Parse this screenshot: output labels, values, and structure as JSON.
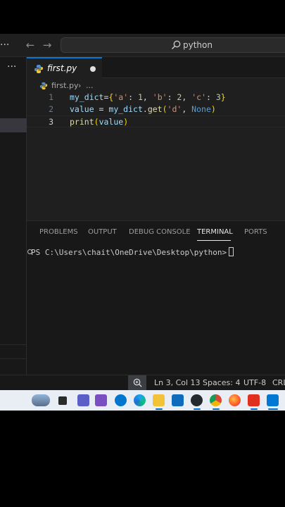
{
  "title_bar": {
    "more_glyph": "···",
    "back_glyph": "←",
    "forward_glyph": "→",
    "search_text": "python"
  },
  "sidebar": {
    "more_glyph": "···"
  },
  "editor_tab": {
    "filename": "first.py"
  },
  "breadcrumb": {
    "file": "first.py",
    "separator": "›",
    "ellipsis": "..."
  },
  "code": {
    "line_numbers": [
      "1",
      "2",
      "3"
    ],
    "line1": {
      "var": "my_dict",
      "eq": "=",
      "lb": "{",
      "k1": "'a'",
      "c1": ": ",
      "v1": "1",
      "s1": ", ",
      "k2": "'b'",
      "c2": ": ",
      "v2": "2",
      "s2": ", ",
      "k3": "'c'",
      "c3": ": ",
      "v3": "3",
      "rb": "}"
    },
    "line2": {
      "var": "value",
      "eq": " = ",
      "obj": "my_dict",
      "dot": ".",
      "method": "get",
      "lp": "(",
      "arg": "'d'",
      "comma": ", ",
      "none": "None",
      "rp": ")"
    },
    "line3": {
      "fn": "print",
      "lp": "(",
      "arg": "value",
      "rp": ")"
    }
  },
  "panel": {
    "tabs": [
      "PROBLEMS",
      "OUTPUT",
      "DEBUG CONSOLE",
      "TERMINAL",
      "PORTS"
    ],
    "active_tab": "TERMINAL",
    "terminal_prompt": "PS C:\\Users\\chait\\OneDrive\\Desktop\\python>"
  },
  "status_bar": {
    "zoom_icon": "zoom-in-icon",
    "position": "Ln 3, Col 13",
    "spaces": "Spaces: 4",
    "encoding": "UTF-8",
    "eol": "CRLF"
  },
  "colors": {
    "accent": "#0078d4",
    "editor_bg": "#1f1f1f",
    "panel_bg": "#181818",
    "taskbar_bg": "#e9eef5"
  },
  "taskbar_icons": [
    "weather-icon",
    "task-view-icon",
    "teams-icon",
    "calendar-icon",
    "dell-icon",
    "edge-icon",
    "file-explorer-icon",
    "store-icon",
    "github-desktop-icon",
    "chrome-icon",
    "firefox-icon",
    "wps-office-icon",
    "vscode-icon"
  ]
}
